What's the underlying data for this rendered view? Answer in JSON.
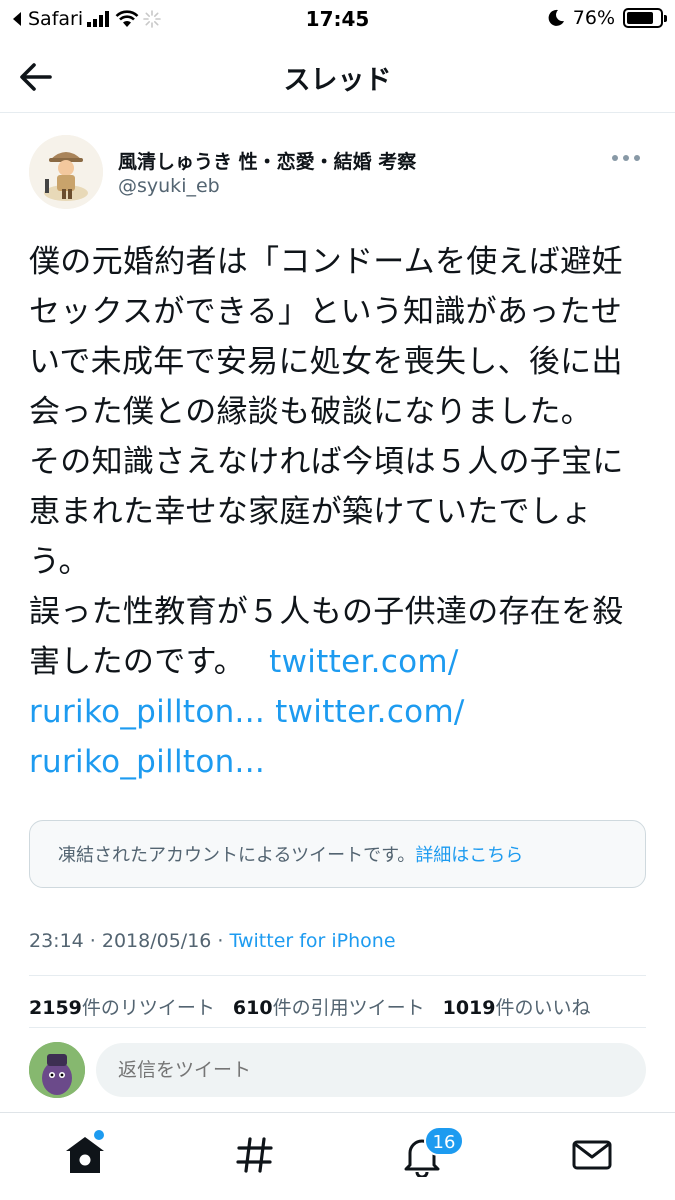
{
  "status_bar": {
    "carrier": "Safari",
    "time": "17:45",
    "battery": "76%"
  },
  "header": {
    "title": "スレッド"
  },
  "tweet": {
    "author_name": "風清しゅうき 性・恋愛・結婚 考察",
    "author_handle": "@syuki_eb",
    "text_lines": [
      "僕の元婚約者は「コンドームを使えば避妊",
      "セックスができる」という知識があったせ",
      "いで未成年で安易に処女を喪失し、後に出",
      "会った僕との縁談も破談になりました。",
      "その知識さえなければ今頃は５人の子宝に",
      "恵まれた幸せな家庭が築けていたでしょ",
      "う。",
      "誤った性教育が５人もの子供達の存在を殺"
    ],
    "last_text": "害したのです。",
    "links": [
      "twitter.com/",
      "ruriko_pillton...",
      "twitter.com/",
      "ruriko_pillton..."
    ],
    "suspended_notice": "凍結されたアカウントによるツイートです。",
    "suspended_link": "詳細はこちら",
    "timestamp": "23:14 · 2018/05/16 · ",
    "source": "Twitter for iPhone",
    "stats": {
      "retweets_count": "2159",
      "retweets_label": "件のリツイート",
      "quotes_count": "610",
      "quotes_label": "件の引用ツイート",
      "likes_count": "1019",
      "likes_label": "件のいいね"
    }
  },
  "reply": {
    "placeholder": "返信をツイート"
  },
  "tabbar": {
    "notification_badge": "16"
  },
  "colors": {
    "accent": "#1d9bf0",
    "text": "#0f1419",
    "muted": "#536471"
  },
  "icons": [
    "back-arrow-icon",
    "more-icon",
    "home-icon",
    "hashtag-icon",
    "bell-icon",
    "envelope-icon",
    "signal-icon",
    "wifi-icon",
    "moon-icon",
    "battery-icon"
  ]
}
